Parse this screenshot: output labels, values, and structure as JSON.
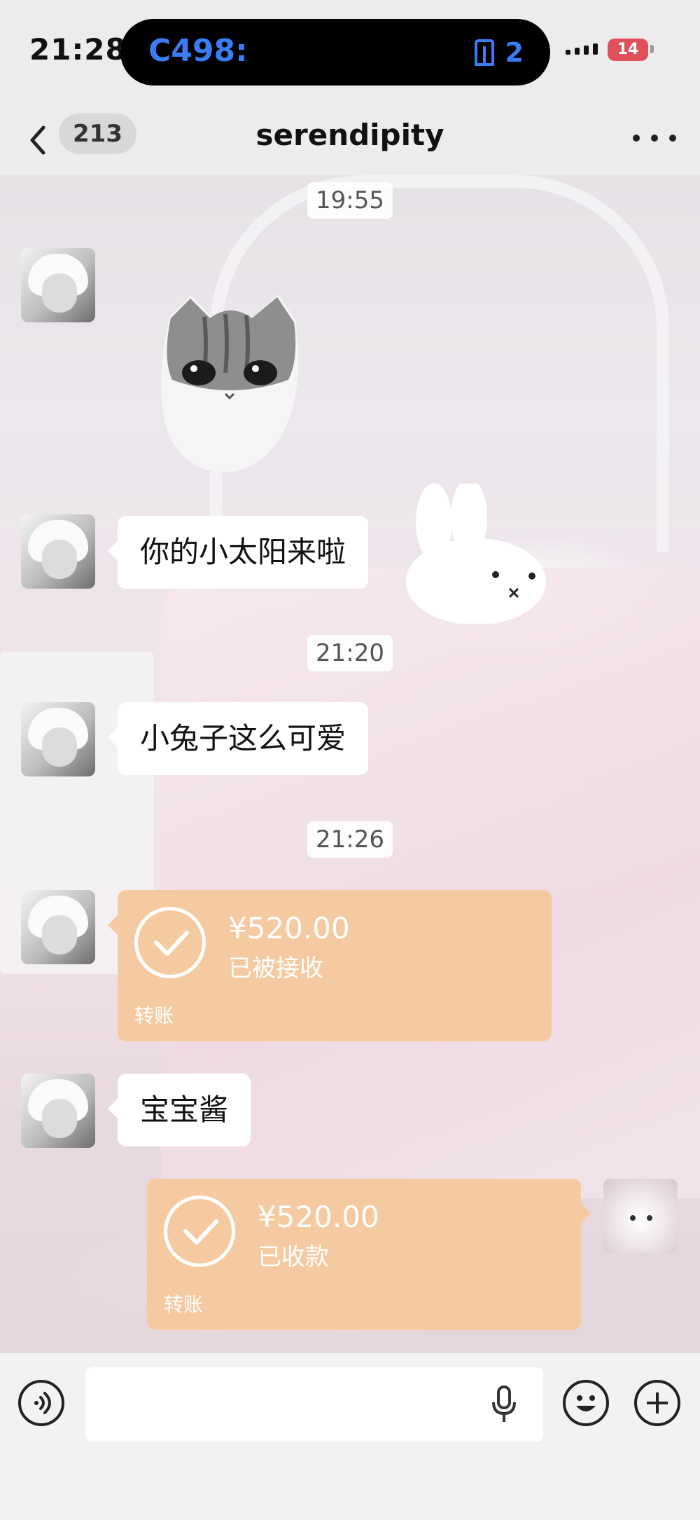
{
  "status_bar": {
    "time": "21:28",
    "island_left_text": "C498:",
    "island_right_count": "2",
    "battery": "14"
  },
  "nav": {
    "unread_count": "213",
    "title": "serendipity"
  },
  "messages": {
    "ts1": "19:55",
    "bubble1": "你的小太阳来啦",
    "ts2": "21:20",
    "bubble2": "小兔子这么可爱",
    "ts3": "21:26",
    "transfer1": {
      "amount": "¥520.00",
      "status": "已被接收",
      "label": "转账"
    },
    "bubble3": "宝宝酱",
    "transfer2": {
      "amount": "¥520.00",
      "status": "已收款",
      "label": "转账"
    }
  },
  "icons": {
    "back": "chevron-left-icon",
    "more": "more-dots-icon",
    "voice": "voice-icon",
    "mic": "microphone-icon",
    "emoji": "emoji-icon",
    "plus": "plus-icon"
  },
  "colors": {
    "transfer_bubble": "#f6caa0",
    "island_text": "#3a7cf6",
    "battery": "#e0505a"
  },
  "input": {
    "value": ""
  }
}
